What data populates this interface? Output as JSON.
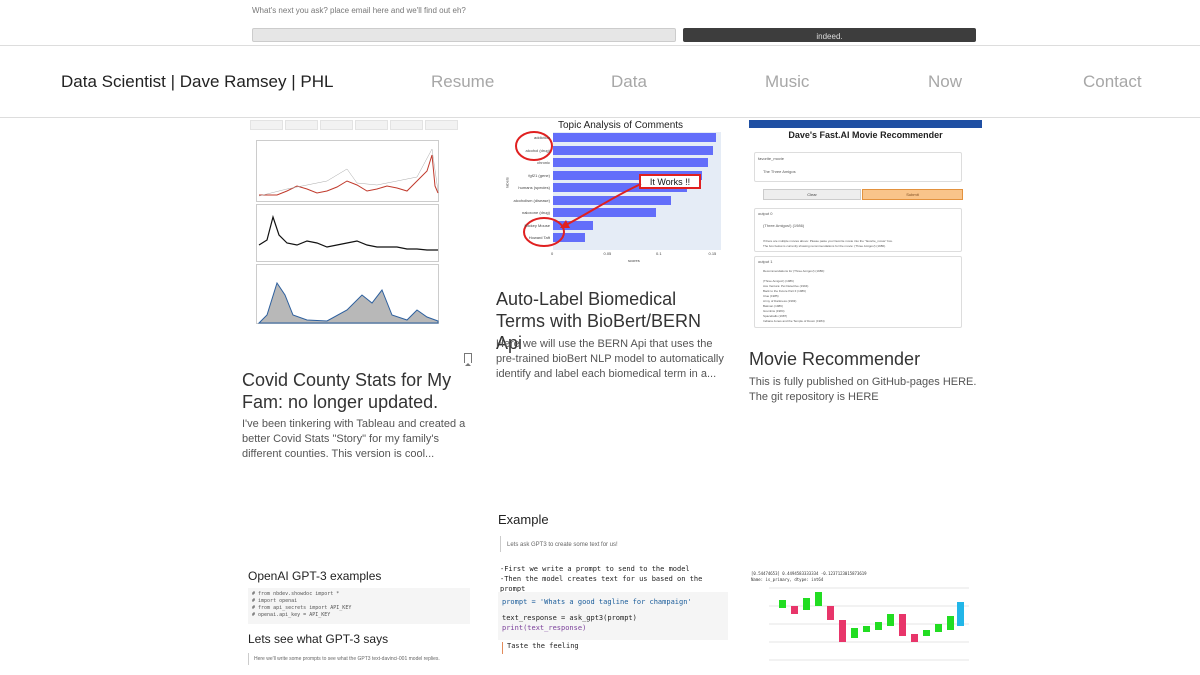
{
  "email": {
    "prompt": "What's next you ask? place email here and we'll find out eh?",
    "placeholder": "",
    "submit_label": "indeed."
  },
  "header": {
    "title": "Data Scientist | Dave Ramsey | PHL",
    "nav": [
      "Resume",
      "Data",
      "Music",
      "Now",
      "Contact"
    ]
  },
  "cards": [
    {
      "title": "Covid County Stats for My Fam: no longer updated.",
      "description": "I've been tinkering with Tableau and created a better Covid Stats \"Story\" for my family's different counties. This version is cool..."
    },
    {
      "title": "Auto-Label Biomedical Terms with BioBert/BERN Api",
      "description": "Here we will use the BERN Api that uses the pre-trained bioBert NLP model to automatically identify and label each biomedical term in a..."
    },
    {
      "title": "Movie Recommender",
      "description": "This is fully published on GitHub-pages HERE. The git repository is HERE"
    }
  ],
  "thumb_topic": {
    "title": "Topic Analysis of Comments",
    "annotation": "It Works !!",
    "ylabel": "labels",
    "xlabel": "scores",
    "ticks": [
      "0",
      "0.05",
      "0.1",
      "0.15"
    ],
    "labels": [
      "addiction",
      "alcohol (drug)",
      "chronic",
      "fgf21 (gene)",
      "humans (species)",
      "alcoholism (disease)",
      "naloxone (drug)",
      "Mickey Mouse",
      "Howard Taft"
    ],
    "values": [
      0.155,
      0.152,
      0.148,
      0.142,
      0.128,
      0.112,
      0.098,
      0.038,
      0.03
    ]
  },
  "thumb_movie": {
    "title": "Dave's Fast.AI Movie Recommender",
    "field_label": "favorite_movie",
    "field_value": "The Three Amigos",
    "clear": "Clear",
    "submit": "Submit",
    "output0_label": "output 0",
    "output0_l1": "(Three Amigos!) (1986)",
    "output0_l2": "If there are multiple movies above: Please paste your favorite movie into the \"favorite_movie\" box.",
    "output0_l3": "The box below is currently showing recommendations for the movie: (Three Amigos!) (1986).",
    "output1_label": "output 1",
    "recs": [
      "Recommendations for (Three Amigos!) (1986):",
      "",
      "(Three Amigos!) (1986)",
      "Ace Ventura: Pet Detective (1994)",
      "Back to the Future Part II (1989)",
      "Clue (1985)",
      "Army of Darkness (1993)",
      "Batman (1989)",
      "Gremlins (1984)",
      "Spaceballs (1987)",
      "Indiana Jones and the Temple of Doom (1984)"
    ]
  },
  "thumb_openai": {
    "heading": "OpenAI GPT-3 examples",
    "code": [
      "# from nbdev.showdoc import *",
      "# import openai",
      "# from api_secrets import API_KEY",
      "# openai.api_key = API_KEY"
    ],
    "subheading": "Lets see what GPT-3 says",
    "note": "Here we'll write some prompts to see what the GPT3 text-davinci-001 model replies."
  },
  "thumb_example": {
    "heading": "Example",
    "quote": "Lets ask GPT3 to create some text for us!",
    "steps": [
      "-First we write a prompt to send to the model",
      "-Then the model creates text for us based on the prompt"
    ],
    "code": [
      "prompt = 'Whats a good tagline for champaign'",
      "",
      "text_response = ask_gpt3(prompt)",
      "print(text_response)"
    ],
    "output": "Taste the feeling"
  },
  "thumb_waterfall": {
    "header_line1": "[0.54474653] 0.4494583333334  -0.1237123015873619",
    "header_line2": "Name: is_primary, dtype: int64",
    "colors": {
      "up": "#22dd22",
      "down": "#e8356a",
      "total": "#22b6e8"
    }
  }
}
